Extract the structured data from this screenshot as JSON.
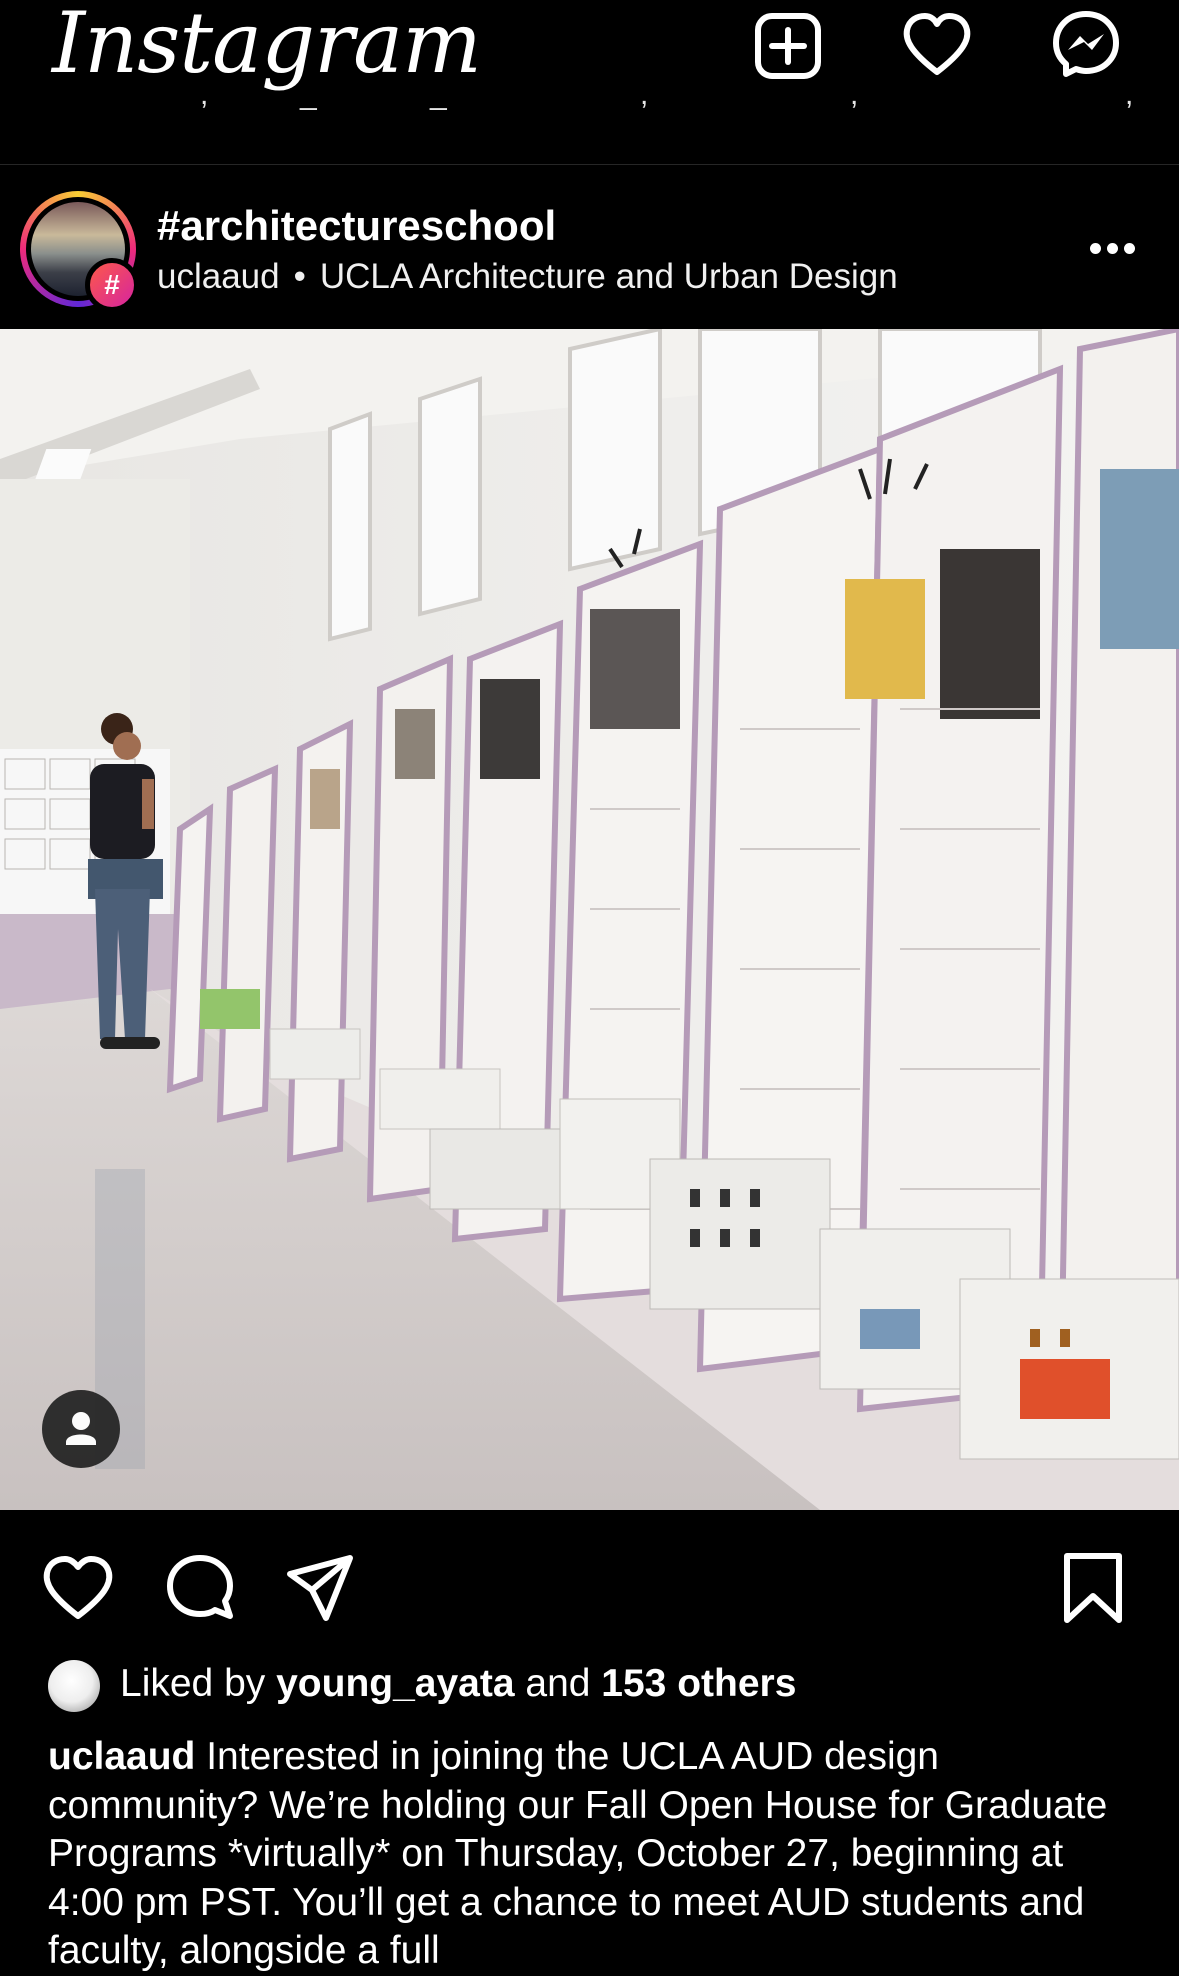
{
  "app": {
    "logo_text": "Instagram",
    "icons": {
      "create": "plus-square-icon",
      "activity": "heart-icon",
      "messages": "messenger-icon"
    }
  },
  "post": {
    "title": "#architectureschool",
    "username": "uclaaud",
    "subtitle": "UCLA Architecture and Urban Design",
    "hashtag_badge": "#",
    "likes": {
      "prefix": "Liked by",
      "user": "young_ayata",
      "middle": "and",
      "count_text": "153 others"
    },
    "caption": {
      "username": "uclaaud",
      "text": "Interested in joining the UCLA AUD design community? We’re holding our Fall Open House for Graduate Programs *virtually* on Thursday, October 27, beginning at 4:00 pm PST. You’ll get a chance to meet AUD students and faculty, alongside a full"
    }
  }
}
